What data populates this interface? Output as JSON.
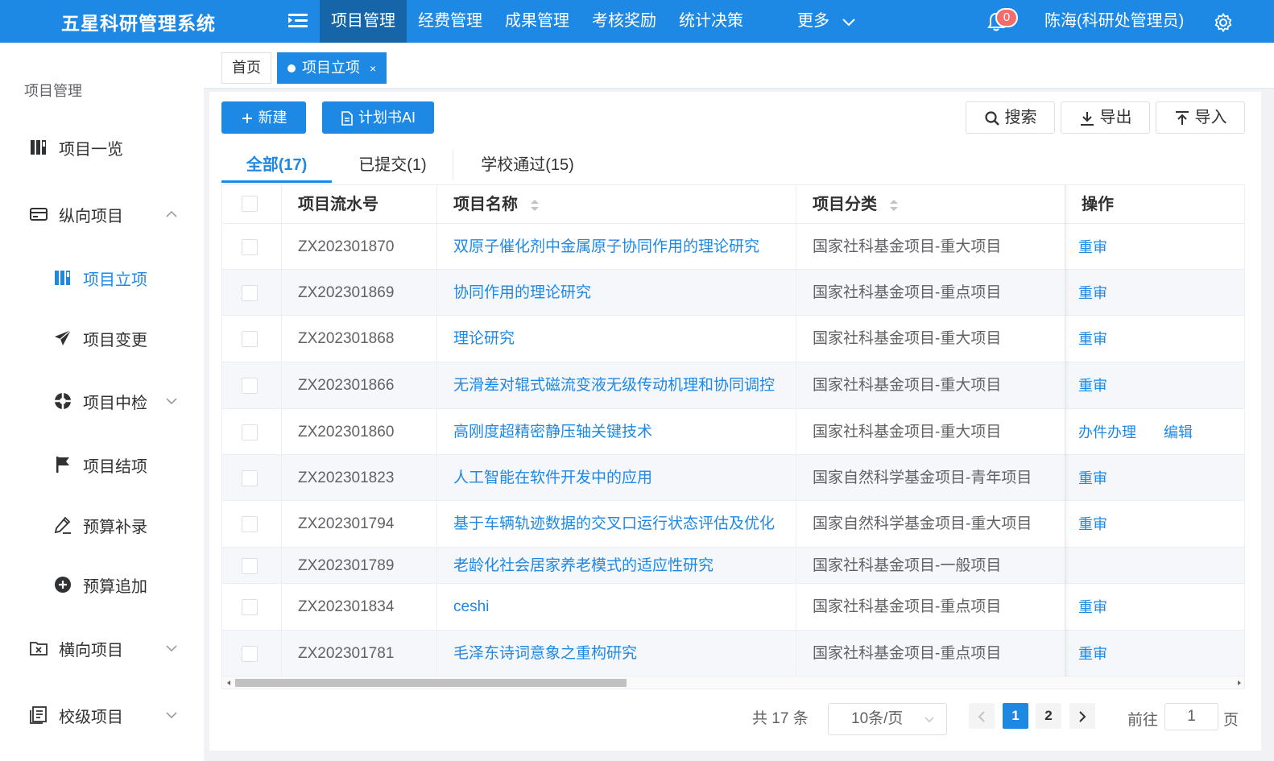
{
  "app": {
    "title": "五星科研管理系统"
  },
  "topnav": {
    "items": [
      "项目管理",
      "经费管理",
      "成果管理",
      "考核奖励",
      "统计决策"
    ],
    "more": "更多",
    "notif_count": "0",
    "user": "陈海(科研处管理员)"
  },
  "sidebar": {
    "title": "项目管理",
    "items": [
      {
        "label": "项目一览"
      },
      {
        "label": "纵向项目"
      },
      {
        "label": "项目立项"
      },
      {
        "label": "项目变更"
      },
      {
        "label": "项目中检"
      },
      {
        "label": "项目结项"
      },
      {
        "label": "预算补录"
      },
      {
        "label": "预算追加"
      },
      {
        "label": "横向项目"
      },
      {
        "label": "校级项目"
      }
    ]
  },
  "pagetabs": {
    "home": "首页",
    "current": "项目立项",
    "close": "×"
  },
  "toolbar": {
    "new": "新建",
    "ai": "计划书AI",
    "search": "搜索",
    "export": "导出",
    "import": "导入"
  },
  "subtabs": [
    "全部(17)",
    "已提交(1)",
    "学校通过(15)"
  ],
  "table": {
    "headers": {
      "serial": "项目流水号",
      "name": "项目名称",
      "category": "项目分类",
      "action": "操作"
    },
    "rows": [
      {
        "serial": "ZX202301870",
        "name": "双原子催化剂中金属原子协同作用的理论研究",
        "category": "国家社科基金项目-重大项目",
        "op1": "重审",
        "op2": ""
      },
      {
        "serial": "ZX202301869",
        "name": "协同作用的理论研究",
        "category": "国家社科基金项目-重点项目",
        "op1": "重审",
        "op2": ""
      },
      {
        "serial": "ZX202301868",
        "name": "理论研究",
        "category": "国家社科基金项目-重大项目",
        "op1": "重审",
        "op2": ""
      },
      {
        "serial": "ZX202301866",
        "name": "无滑差对辊式磁流变液无级传动机理和协同调控",
        "category": "国家社科基金项目-重大项目",
        "op1": "重审",
        "op2": ""
      },
      {
        "serial": "ZX202301860",
        "name": "高刚度超精密静压轴关键技术",
        "category": "国家社科基金项目-重大项目",
        "op1": "办件办理",
        "op2": "编辑"
      },
      {
        "serial": "ZX202301823",
        "name": "人工智能在软件开发中的应用",
        "category": "国家自然科学基金项目-青年项目",
        "op1": "重审",
        "op2": ""
      },
      {
        "serial": "ZX202301794",
        "name": "基于车辆轨迹数据的交叉口运行状态评估及优化",
        "category": "国家自然科学基金项目-重大项目",
        "op1": "重审",
        "op2": ""
      },
      {
        "serial": "ZX202301789",
        "name": "老龄化社会居家养老模式的适应性研究",
        "category": "国家社科基金项目-一般项目",
        "op1": "",
        "op2": ""
      },
      {
        "serial": "ZX202301834",
        "name": "ceshi",
        "category": "国家社科基金项目-重点项目",
        "op1": "重审",
        "op2": ""
      },
      {
        "serial": "ZX202301781",
        "name": "毛泽东诗词意象之重构研究",
        "category": "国家社科基金项目-重点项目",
        "op1": "重审",
        "op2": ""
      }
    ]
  },
  "pagination": {
    "total": "共 17 条",
    "page_size": "10条/页",
    "pages": [
      "1",
      "2"
    ],
    "goto_label": "前往",
    "goto_value": "1",
    "page_unit": "页"
  },
  "colors": {
    "primary": "#1e88e5",
    "topbar": "#1e88e5",
    "active_nav": "#1565a8",
    "badge": "#f56c6c"
  }
}
